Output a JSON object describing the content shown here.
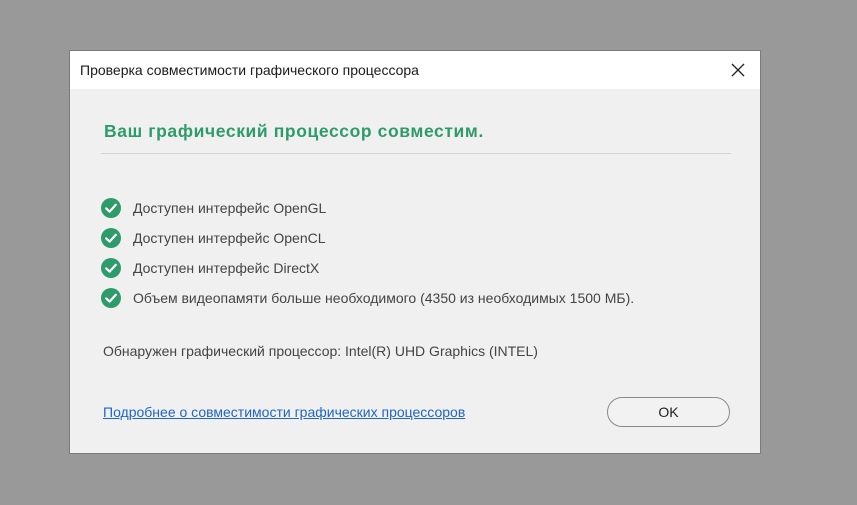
{
  "dialog": {
    "title": "Проверка совместимости графического процессора",
    "heading": "Ваш графический процессор совместим.",
    "checks": [
      {
        "label": "Доступен интерфейс OpenGL",
        "icon": "check-circle-icon"
      },
      {
        "label": "Доступен интерфейс OpenCL",
        "icon": "check-circle-icon"
      },
      {
        "label": "Доступен интерфейс DirectX",
        "icon": "check-circle-icon"
      },
      {
        "label": "Объем видеопамяти больше необходимого (4350 из необходимых 1500 МБ).",
        "icon": "check-circle-icon"
      }
    ],
    "detected_text": "Обнаружен графический процессор: Intel(R) UHD Graphics (INTEL)",
    "more_link": "Подробнее о совместимости графических процессоров",
    "ok_label": "OK"
  },
  "colors": {
    "accent": "#2e9b6a",
    "link": "#2066c3",
    "backdrop": "#999999"
  }
}
